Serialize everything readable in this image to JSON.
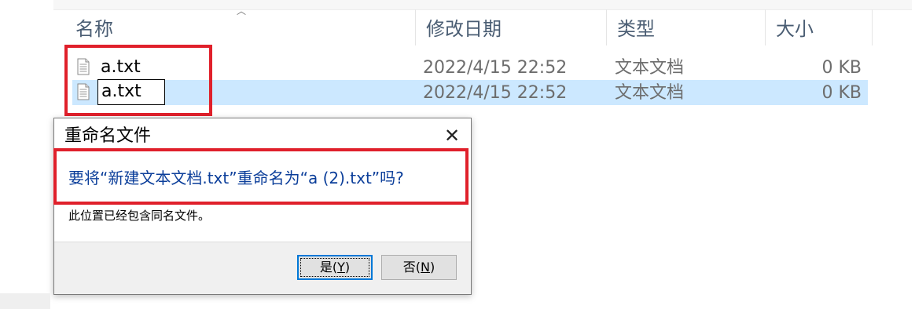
{
  "columns": {
    "name": "名称",
    "modified": "修改日期",
    "type": "类型",
    "size": "大小"
  },
  "files": [
    {
      "name": "a.txt",
      "modified": "2022/4/15 22:52",
      "type": "文本文档",
      "size": "0 KB",
      "icon": "text-file-icon"
    },
    {
      "name": "a.txt",
      "modified": "2022/4/15 22:52",
      "type": "文本文档",
      "size": "0 KB",
      "icon": "text-file-icon",
      "selected": true,
      "editing": true
    }
  ],
  "dialog": {
    "title": "重命名文件",
    "close_glyph": "✕",
    "question": "要将“新建文本文档.txt”重命名为“a (2).txt”吗?",
    "info": "此位置已经包含同名文件。",
    "yes_label_prefix": "是(",
    "yes_key": "Y",
    "yes_label_suffix": ")",
    "no_label_prefix": "否(",
    "no_key": "N",
    "no_label_suffix": ")"
  },
  "colors": {
    "highlight_red": "#e0202b",
    "selection_blue": "#cce8ff",
    "question_blue": "#0b3e9a"
  }
}
